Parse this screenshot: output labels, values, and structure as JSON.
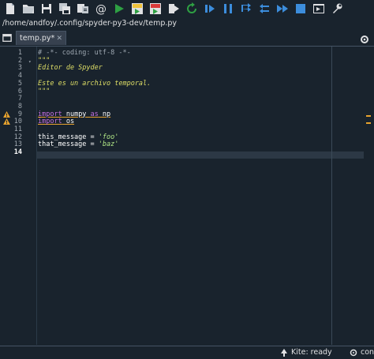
{
  "toolbar": {
    "icons": [
      "new-file-icon",
      "open-file-icon",
      "save-icon",
      "save-all-icon",
      "file-switcher-icon",
      "at-icon",
      "run-icon",
      "run-cell-icon",
      "run-cell-advance-icon",
      "run-selection-icon",
      "rerun-icon",
      "debug-icon",
      "step-icon",
      "step-into-icon",
      "step-return-icon",
      "continue-icon",
      "stop-icon",
      "maximize-pane-icon",
      "preferences-icon"
    ]
  },
  "path": "/home/andfoy/.config/spyder-py3-dev/temp.py",
  "tab": {
    "label": "temp.py*",
    "close": "✕"
  },
  "editor": {
    "current_line": 14,
    "lines": [
      {
        "n": "1",
        "segments": [
          {
            "t": "# -*- coding: utf-8 -*-",
            "c": "c-comment"
          }
        ]
      },
      {
        "n": "2",
        "segments": [
          {
            "t": "\"\"\"",
            "c": "c-doc"
          }
        ]
      },
      {
        "n": "3",
        "segments": [
          {
            "t": "Editor de Spyder",
            "c": "c-doc"
          }
        ]
      },
      {
        "n": "4",
        "segments": [
          {
            "t": "",
            "c": "c-doc"
          }
        ]
      },
      {
        "n": "5",
        "segments": [
          {
            "t": "Este es un archivo temporal.",
            "c": "c-doc"
          }
        ]
      },
      {
        "n": "6",
        "segments": [
          {
            "t": "\"\"\"",
            "c": "c-doc"
          }
        ]
      },
      {
        "n": "7",
        "segments": []
      },
      {
        "n": "8",
        "segments": []
      },
      {
        "n": "9",
        "segments": [
          {
            "t": "import",
            "c": "c-kw"
          },
          {
            "t": " numpy ",
            "c": "c-name c-warnul"
          },
          {
            "t": "as",
            "c": "c-kw"
          },
          {
            "t": " np",
            "c": "c-name c-warnul"
          }
        ]
      },
      {
        "n": "10",
        "segments": [
          {
            "t": "import",
            "c": "c-kw"
          },
          {
            "t": " os",
            "c": "c-name c-warnul"
          }
        ]
      },
      {
        "n": "11",
        "segments": []
      },
      {
        "n": "12",
        "segments": [
          {
            "t": "this_message = ",
            "c": "c-name"
          },
          {
            "t": "'foo'",
            "c": "c-str"
          }
        ]
      },
      {
        "n": "13",
        "segments": [
          {
            "t": "that_message = ",
            "c": "c-name"
          },
          {
            "t": "'baz'",
            "c": "c-str"
          }
        ]
      },
      {
        "n": "14",
        "segments": []
      }
    ],
    "warning_lines": [
      "9",
      "10"
    ],
    "fold_lines": [
      "2"
    ]
  },
  "status": {
    "kite": "Kite: ready",
    "conda": "con"
  },
  "colors": {
    "background": "#19232d",
    "warning": "#e8a32e",
    "keyword": "#c670e0",
    "string": "#b0e686",
    "docstring": "#dede66"
  }
}
